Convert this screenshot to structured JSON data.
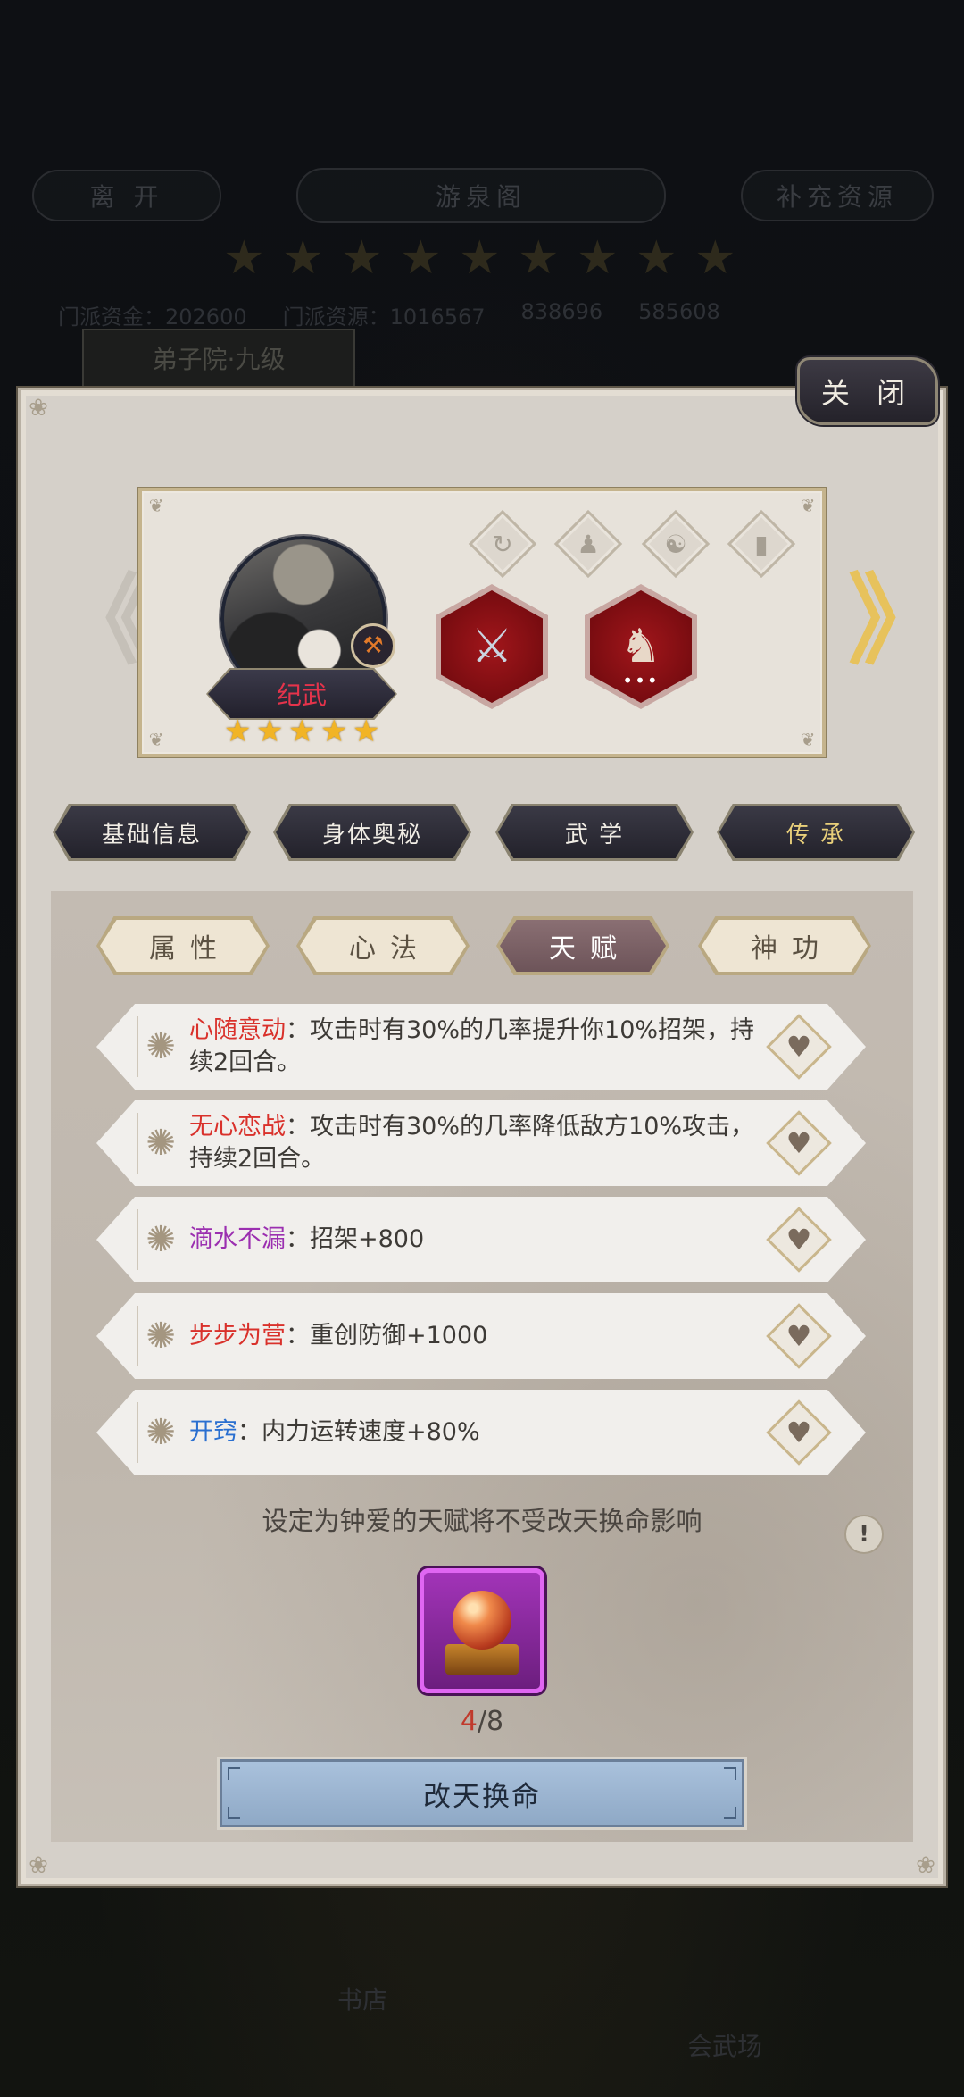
{
  "background": {
    "leave_label": "离 开",
    "location_title": "游泉阁",
    "replenish_label": "补充资源",
    "resources": [
      "门派资金：202600",
      "门派资源：1016567",
      "838696",
      "585608"
    ],
    "building_tag": "弟子院·九级",
    "bottom_labels": [
      "书店",
      "会武场"
    ]
  },
  "dialog": {
    "close_label": "关 闭"
  },
  "character": {
    "name": "纪武",
    "stars": 5,
    "star_glyph": "★",
    "name_color": "#e5334b",
    "equip_slots": [
      "spin-icon",
      "figure-icon",
      "yin-yang-icon",
      "book-icon"
    ],
    "skill_items": [
      "blade-icon",
      "beast-icon"
    ],
    "skill_more_indicator": "•••"
  },
  "nav": {
    "prev_glyph": "《",
    "next_glyph": "》"
  },
  "top_tabs": [
    {
      "label": "基础信息",
      "active": false
    },
    {
      "label": "身体奥秘",
      "active": false
    },
    {
      "label": "武 学",
      "active": false
    },
    {
      "label": "传 承",
      "active": true
    }
  ],
  "sub_tabs": [
    {
      "label": "属性",
      "active": false
    },
    {
      "label": "心法",
      "active": false
    },
    {
      "label": "天赋",
      "active": true
    },
    {
      "label": "神功",
      "active": false
    }
  ],
  "talents": [
    {
      "name": "心随意动",
      "color": "#d9312b",
      "sep": "：",
      "desc": "攻击时有30%的几率提升你10%招架，持续2回合。"
    },
    {
      "name": "无心恋战",
      "color": "#d9312b",
      "sep": "：",
      "desc": "攻击时有30%的几率降低敌方10%攻击，持续2回合。"
    },
    {
      "name": "滴水不漏",
      "color": "#9b2fb0",
      "sep": "：",
      "desc": "招架+800"
    },
    {
      "name": "步步为营",
      "color": "#d9312b",
      "sep": "：",
      "desc": "重创防御+1000"
    },
    {
      "name": "开窍",
      "color": "#2a6fd0",
      "sep": "：",
      "desc": "内力运转速度+80%"
    }
  ],
  "note": "设定为钟爱的天赋将不受改天换命影响",
  "info_glyph": "!",
  "item": {
    "current": "4",
    "total": "/8"
  },
  "action_label": "改天换命",
  "accent_colors": {
    "panel_bg": "#d5d0c9",
    "active_subtab": "#8a6f73",
    "action_button": "#a9c1dc"
  }
}
